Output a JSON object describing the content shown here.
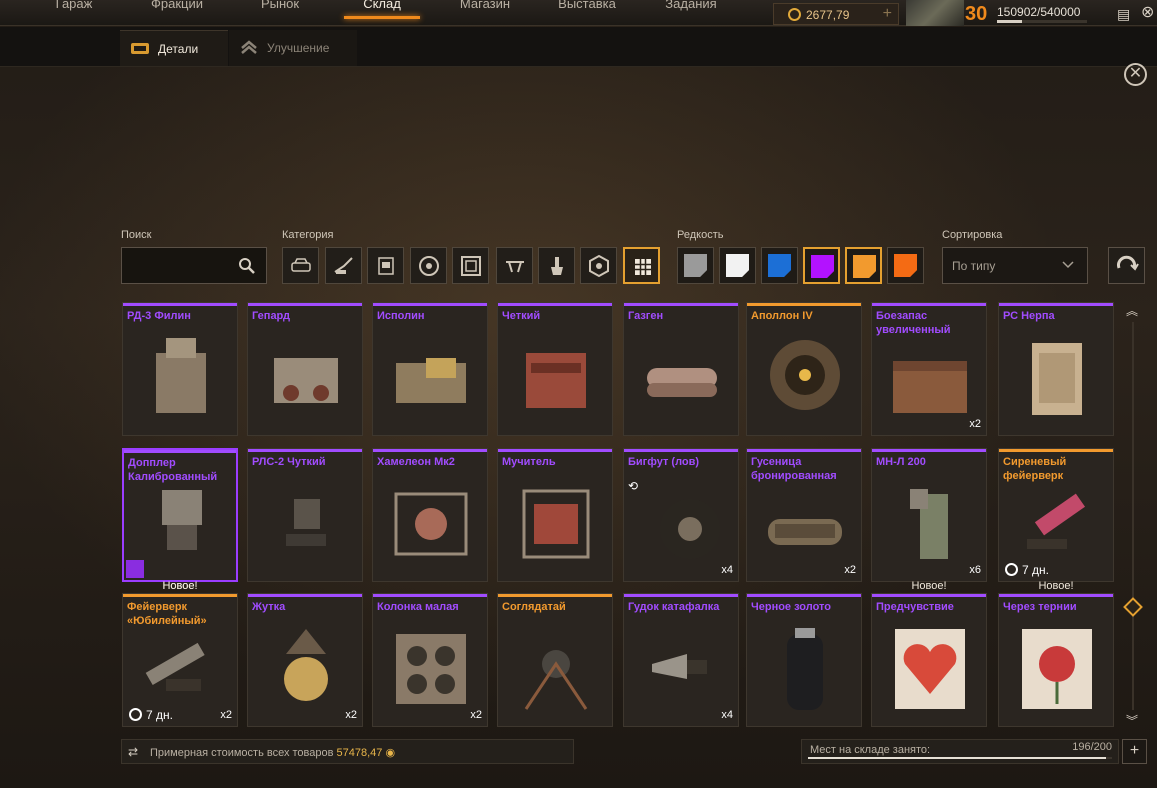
{
  "nav": {
    "tabs": [
      "Гараж",
      "Фракции",
      "Рынок",
      "Склад",
      "Магазин",
      "Выставка",
      "Задания"
    ],
    "active": "Склад"
  },
  "header": {
    "currency": "2677,79",
    "level": "30",
    "xp": "150902/540000",
    "xp_fraction": 0.279
  },
  "subtabs": {
    "details": "Детали",
    "upgrade": "Улучшение"
  },
  "filters": {
    "search_label": "Поиск",
    "search_value": "",
    "category_label": "Категория",
    "categories": [
      "cabin-icon",
      "weapon-icon",
      "module-icon",
      "wheel-icon",
      "frame-icon",
      "melee-icon",
      "decor-icon",
      "paint-icon",
      "hardware-icon",
      "all-icon"
    ],
    "category_active": "all-icon",
    "rarity_label": "Редкость",
    "rarities": [
      {
        "name": "common",
        "color": "#9a9a9a"
      },
      {
        "name": "rare-white",
        "color": "#f2f2f2"
      },
      {
        "name": "special",
        "color": "#1c6fd6"
      },
      {
        "name": "epic",
        "color": "#b312ff"
      },
      {
        "name": "legendary",
        "color": "#f29a2e"
      },
      {
        "name": "relic",
        "color": "#f46b14"
      }
    ],
    "rarity_active": [
      "epic",
      "legendary"
    ],
    "sort_label": "Сортировка",
    "sort_value": "По типу"
  },
  "items": [
    {
      "name": "РД-3 Филин",
      "rarity": "epic",
      "qty": "",
      "timer": "",
      "new": false
    },
    {
      "name": "Гепард",
      "rarity": "epic",
      "qty": "",
      "timer": "",
      "new": false
    },
    {
      "name": "Исполин",
      "rarity": "epic",
      "qty": "",
      "timer": "",
      "new": false
    },
    {
      "name": "Четкий",
      "rarity": "epic",
      "qty": "",
      "timer": "",
      "new": false
    },
    {
      "name": "Газген",
      "rarity": "epic",
      "qty": "",
      "timer": "",
      "new": false
    },
    {
      "name": "Аполлон IV",
      "rarity": "legendary",
      "qty": "",
      "timer": "",
      "new": false
    },
    {
      "name": "Боезапас увеличенный",
      "rarity": "epic",
      "qty": "x2",
      "timer": "",
      "new": false
    },
    {
      "name": "РС Нерпа",
      "rarity": "epic",
      "qty": "",
      "timer": "",
      "new": false
    },
    {
      "name": "Допплер Калиброванный",
      "rarity": "epic",
      "qty": "",
      "timer": "",
      "new": false,
      "selected": true
    },
    {
      "name": "РЛС-2 Чуткий",
      "rarity": "epic",
      "qty": "",
      "timer": "",
      "new": false
    },
    {
      "name": "Хамелеон Мк2",
      "rarity": "epic",
      "qty": "",
      "timer": "",
      "new": false
    },
    {
      "name": "Мучитель",
      "rarity": "epic",
      "qty": "",
      "timer": "",
      "new": false
    },
    {
      "name": "Бигфут (лов)",
      "rarity": "epic",
      "qty": "x4",
      "timer": "",
      "new": false
    },
    {
      "name": "Гусеница бронированная",
      "rarity": "epic",
      "qty": "x2",
      "timer": "",
      "new": false
    },
    {
      "name": "МН-Л 200",
      "rarity": "epic",
      "qty": "x6",
      "timer": "",
      "new": false
    },
    {
      "name": "Сиреневый фейерверк",
      "rarity": "legendary",
      "qty": "",
      "timer": "7 дн.",
      "new": true
    },
    {
      "name": "Фейерверк «Юбилейный»",
      "rarity": "legendary",
      "qty": "x2",
      "timer": "7 дн.",
      "new": true
    },
    {
      "name": "Жутка",
      "rarity": "epic",
      "qty": "x2",
      "timer": "",
      "new": false
    },
    {
      "name": "Колонка малая",
      "rarity": "epic",
      "qty": "x2",
      "timer": "",
      "new": false
    },
    {
      "name": "Соглядатай",
      "rarity": "legendary",
      "qty": "",
      "timer": "",
      "new": false
    },
    {
      "name": "Гудок катафалка",
      "rarity": "epic",
      "qty": "x4",
      "timer": "",
      "new": false
    },
    {
      "name": "Черное золото",
      "rarity": "epic",
      "qty": "",
      "timer": "",
      "new": false
    },
    {
      "name": "Предчувствие",
      "rarity": "epic",
      "qty": "",
      "timer": "",
      "new": true
    },
    {
      "name": "Через тернии",
      "rarity": "epic",
      "qty": "",
      "timer": "",
      "new": false
    }
  ],
  "new_label": "Новое!",
  "footer": {
    "cost_text": "Примерная стоимость всех товаров",
    "cost_value": "57478,47",
    "storage_text": "Мест на складе занято:",
    "storage_count": "196/200",
    "storage_fraction": 0.98
  },
  "colors": {
    "epic": "#a14cff",
    "legendary": "#f29a2e",
    "accent": "#f08a1c"
  }
}
